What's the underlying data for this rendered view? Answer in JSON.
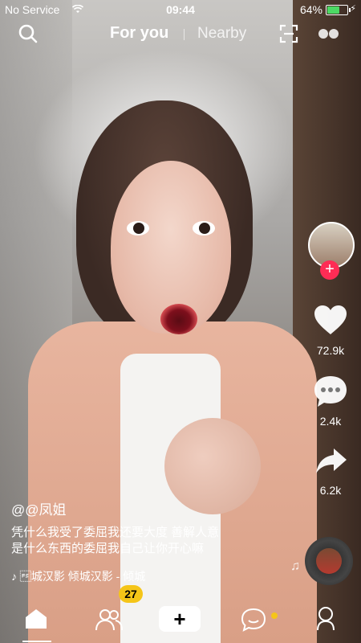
{
  "status_bar": {
    "carrier": "No Service",
    "time": "09:44",
    "battery_percent": "64%",
    "battery_level": 0.64
  },
  "top_nav": {
    "tabs": [
      {
        "label": "For you",
        "active": true
      },
      {
        "label": "Nearby",
        "active": false
      }
    ],
    "icons": [
      "search-icon",
      "scan-icon",
      "dual-dot-icon"
    ]
  },
  "rail": {
    "like_count": "72.9k",
    "comment_count": "2.4k",
    "share_count": "6.2k",
    "follow_icon": "plus-icon"
  },
  "caption": {
    "username": "@@凤姐",
    "line1": "凭什么我受了委屈我还要大度 善解人意",
    "line2": "是什么东西的委屈我自己让你开心嘛"
  },
  "music": {
    "title": "\u001c城汉影    倾城汉影 - 倾城"
  },
  "bottom_nav": {
    "friends_badge": "27",
    "items": [
      "home",
      "friends",
      "add",
      "inbox",
      "me"
    ]
  },
  "colors": {
    "accent_red": "#fe2c55",
    "accent_cyan": "#20d5ec",
    "badge_yellow": "#f5c518",
    "battery_green": "#4cd964"
  }
}
